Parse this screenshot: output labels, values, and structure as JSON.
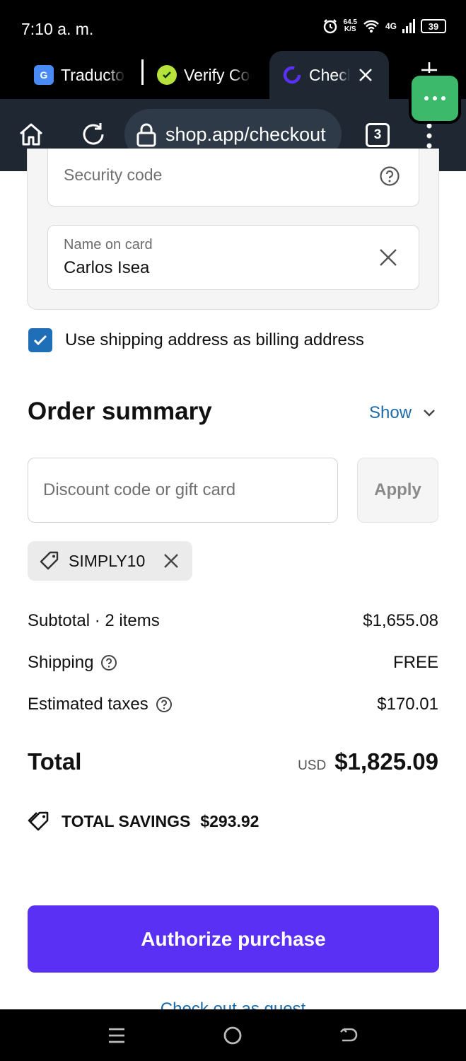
{
  "status_bar": {
    "time": "7:10 a. m.",
    "speed_value": "64.5",
    "speed_unit": "K/S",
    "network": "4G",
    "battery": "39"
  },
  "tabs": [
    {
      "label": "Traductor",
      "icon": "translate-icon"
    },
    {
      "label": "Verify Code",
      "icon": "verify-icon"
    },
    {
      "label": "Checkout",
      "icon": "shop-icon",
      "active": true
    }
  ],
  "toolbar": {
    "url": "shop.app/checkout",
    "tab_count": "3"
  },
  "payment": {
    "security_code_placeholder": "Security code",
    "name_label": "Name on card",
    "name_value": "Carlos Isea"
  },
  "billing": {
    "checkbox_label": "Use shipping address as billing address",
    "checked": true
  },
  "order_summary": {
    "title": "Order summary",
    "show_label": "Show",
    "discount_placeholder": "Discount code or gift card",
    "apply_label": "Apply",
    "applied_code": "SIMPLY10",
    "subtotal_label": "Subtotal · 2 items",
    "subtotal_value": "$1,655.08",
    "shipping_label": "Shipping",
    "shipping_value": "FREE",
    "taxes_label": "Estimated taxes",
    "taxes_value": "$170.01",
    "total_label": "Total",
    "currency": "USD",
    "total_value": "$1,825.09",
    "savings_label": "TOTAL SAVINGS",
    "savings_value": "$293.92"
  },
  "actions": {
    "authorize_label": "Authorize purchase",
    "guest_label": "Check out as guest"
  },
  "colors": {
    "primary_button": "#5a31f4",
    "link": "#1c6aa8",
    "checkbox": "#1e6fb7",
    "browser_toolbar": "#1f2733",
    "fab": "#3cb96a"
  }
}
